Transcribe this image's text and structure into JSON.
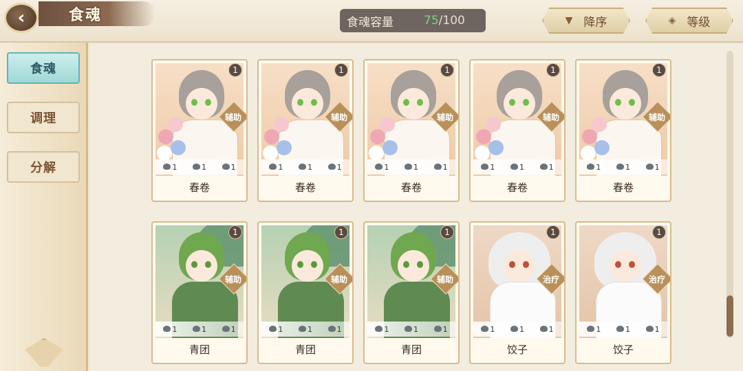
{
  "header": {
    "back_icon": "chevron-left-icon",
    "title": "食魂",
    "capacity_label": "食魂容量",
    "capacity_current": "75",
    "capacity_sep": "/",
    "capacity_max": "100",
    "sort_label": "降序",
    "sort_icon": "triangle-down-icon",
    "filter_label": "等级",
    "filter_icon": "split-icon"
  },
  "sidebar": {
    "items": [
      {
        "label": "食魂",
        "active": true
      },
      {
        "label": "调理",
        "active": false
      },
      {
        "label": "分解",
        "active": false
      }
    ]
  },
  "cards": [
    {
      "name": "春卷",
      "level": "1",
      "role": "辅助",
      "stat_a": "1",
      "stat_b": "1",
      "stat_c": "1",
      "type": "chunjuan"
    },
    {
      "name": "春卷",
      "level": "1",
      "role": "辅助",
      "stat_a": "1",
      "stat_b": "1",
      "stat_c": "1",
      "type": "chunjuan"
    },
    {
      "name": "春卷",
      "level": "1",
      "role": "辅助",
      "stat_a": "1",
      "stat_b": "1",
      "stat_c": "1",
      "type": "chunjuan"
    },
    {
      "name": "春卷",
      "level": "1",
      "role": "辅助",
      "stat_a": "1",
      "stat_b": "1",
      "stat_c": "1",
      "type": "chunjuan"
    },
    {
      "name": "春卷",
      "level": "1",
      "role": "辅助",
      "stat_a": "1",
      "stat_b": "1",
      "stat_c": "1",
      "type": "chunjuan"
    },
    {
      "name": "青团",
      "level": "1",
      "role": "辅助",
      "stat_a": "1",
      "stat_b": "1",
      "stat_c": "1",
      "type": "qingtuan"
    },
    {
      "name": "青团",
      "level": "1",
      "role": "辅助",
      "stat_a": "1",
      "stat_b": "1",
      "stat_c": "1",
      "type": "qingtuan"
    },
    {
      "name": "青团",
      "level": "1",
      "role": "辅助",
      "stat_a": "1",
      "stat_b": "1",
      "stat_c": "1",
      "type": "qingtuan"
    },
    {
      "name": "饺子",
      "level": "1",
      "role": "治疗",
      "stat_a": "1",
      "stat_b": "1",
      "stat_c": "1",
      "type": "jiaozi"
    },
    {
      "name": "饺子",
      "level": "1",
      "role": "治疗",
      "stat_a": "1",
      "stat_b": "1",
      "stat_c": "1",
      "type": "jiaozi"
    }
  ],
  "colors": {
    "accent_teal": "#9fd8d6",
    "capacity_current": "#7ad28a",
    "card_border": "#d8b98a"
  }
}
